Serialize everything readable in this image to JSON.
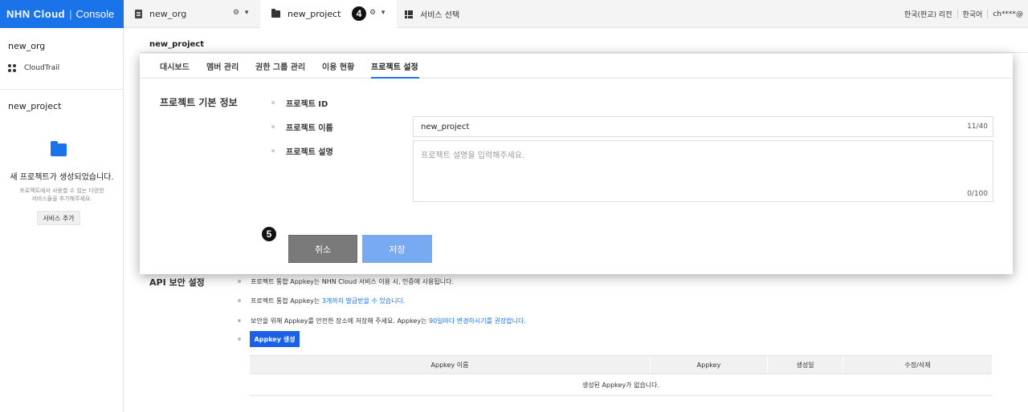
{
  "header": {
    "logo": "NHN Cloud",
    "console": "Console",
    "org_tab": "new_org",
    "project_tab": "new_project",
    "services_tab": "서비스 선택",
    "region": "한국(판교) 리전",
    "language": "한국어",
    "user": "ch****@",
    "step_badge_4": "4"
  },
  "sidebar": {
    "org_name": "new_org",
    "cloudtrail": "CloudTrail",
    "project_name": "new_project",
    "created_msg": "새 프로젝트가 생성되었습니다.",
    "sub_line1": "프로젝트에서 사용할 수 있는 다양한",
    "sub_line2": "서비스들을 추가해주세요.",
    "add_service": "서비스 추가"
  },
  "main": {
    "title": "new_project"
  },
  "modal": {
    "tabs": [
      {
        "label": "대시보드"
      },
      {
        "label": "멤버 관리"
      },
      {
        "label": "권한 그룹 관리"
      },
      {
        "label": "이용 현황"
      },
      {
        "label": "프로젝트 설정"
      }
    ],
    "active_tab": 4,
    "section_title": "프로젝트 기본 정보",
    "label_id": "프로젝트 ID",
    "label_name": "프로젝트 이름",
    "label_desc": "프로젝트 설명",
    "name_value": "new_project",
    "name_count": "11/40",
    "desc_placeholder": "프로젝트 설명을 입력해주세요.",
    "desc_count": "0/100",
    "step_badge_5": "5",
    "cancel": "취소",
    "save": "저장"
  },
  "api": {
    "title": "API 보안 설정",
    "line1": "프로젝트 통합 Appkey는 NHN Cloud 서비스 이용 시, 인증에 사용됩니다.",
    "line2_a": "프로젝트 통합 Appkey는 ",
    "line2_link": "3개까지 발급받을 수 있습니다.",
    "line3_a": "보안을 위해 Appkey를 안전한 장소에 저장해 주세요. Appkey는 ",
    "line3_link": "90일마다 변경하시기를 권장합니다.",
    "create_button": "Appkey 생성",
    "columns": [
      "Appkey 이름",
      "Appkey",
      "생성일",
      "수정/삭제"
    ],
    "empty": "생성된 Appkey가 없습니다."
  },
  "colors": {
    "brand": "#1a73e8",
    "save_disabled": "#77aaf0",
    "cancel": "#7a7a7a"
  }
}
